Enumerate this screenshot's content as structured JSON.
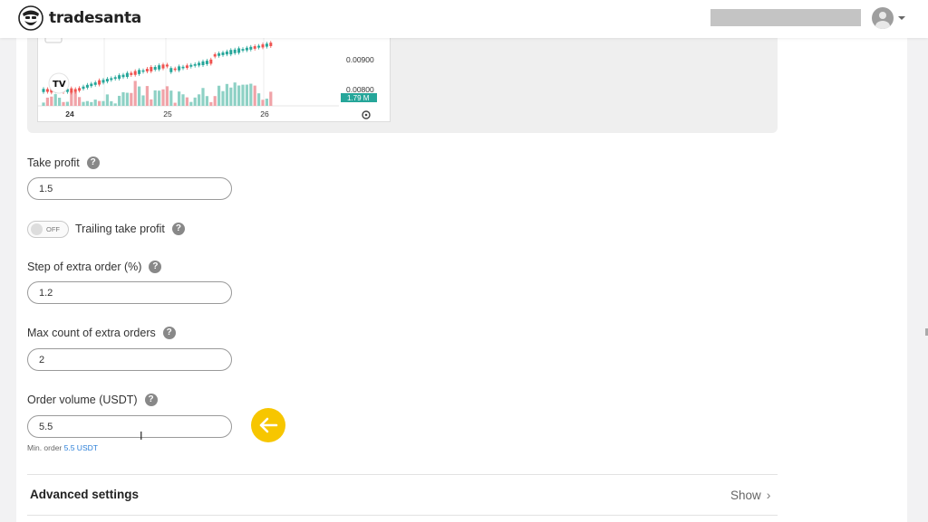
{
  "header": {
    "brand": "tradesanta",
    "search_placeholder": ""
  },
  "chart": {
    "price_labels": [
      "0.00900",
      "0.00800"
    ],
    "volume_badge": "1.79 M",
    "x_ticks": [
      "24",
      "25",
      "26"
    ],
    "colors": {
      "up": "#26a69a",
      "down": "#ef5350",
      "volume_up": "#8ed1c5",
      "volume_down": "#f0a3a8"
    }
  },
  "form": {
    "take_profit": {
      "label": "Take profit",
      "value": "1.5"
    },
    "trailing": {
      "label": "Trailing take profit",
      "toggle_text": "OFF"
    },
    "step": {
      "label": "Step of extra order (%)",
      "value": "1.2"
    },
    "max_count": {
      "label": "Max count of extra orders",
      "value": "2"
    },
    "order_volume": {
      "label": "Order volume (USDT)",
      "value": "5.5",
      "min_prefix": "Min. order ",
      "min_value": "5.5 USDT"
    },
    "help_glyph": "?"
  },
  "advanced": {
    "title": "Advanced settings",
    "show_label": "Show",
    "chevron": "›"
  },
  "accent": {
    "arrow_button": "#f7c600",
    "link": "#2b7fd8"
  }
}
